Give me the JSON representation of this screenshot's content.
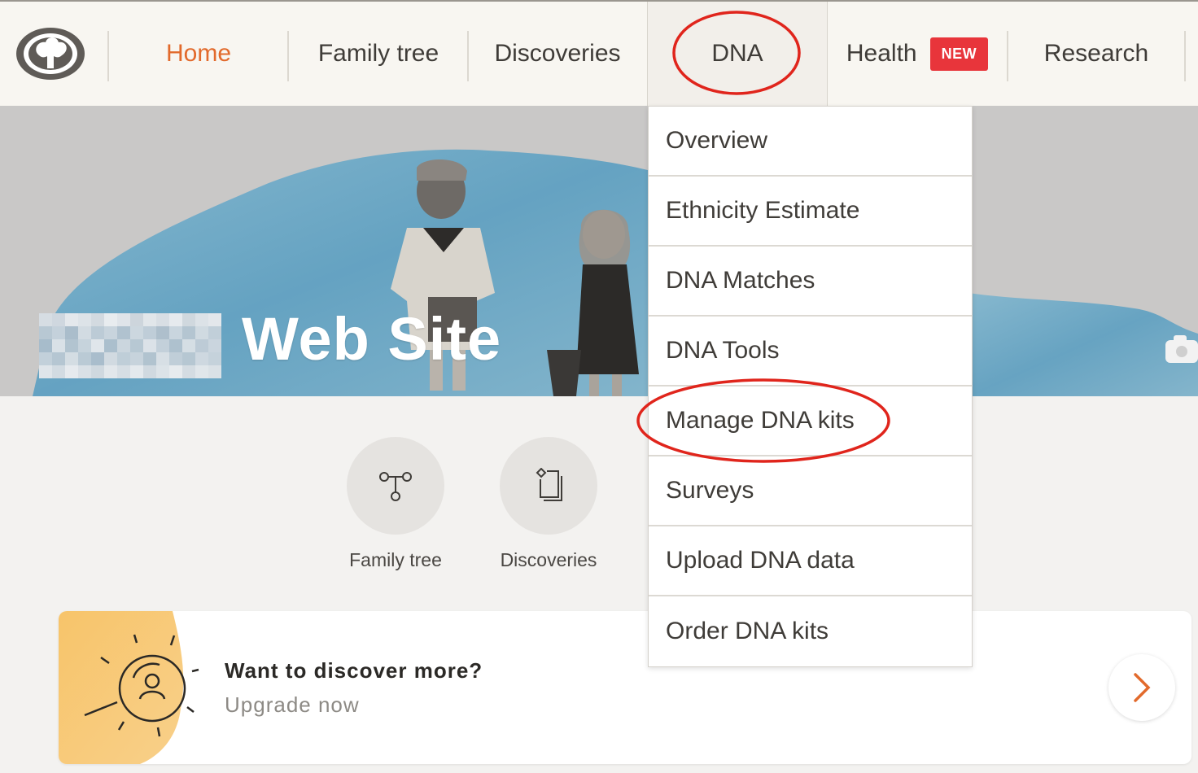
{
  "nav": {
    "items": [
      {
        "label": "Home"
      },
      {
        "label": "Family tree"
      },
      {
        "label": "Discoveries"
      },
      {
        "label": "DNA"
      },
      {
        "label": "Health",
        "badge": "NEW"
      },
      {
        "label": "Research"
      }
    ]
  },
  "hero": {
    "title": "Web Site"
  },
  "quick_links": [
    {
      "label": "Family tree",
      "icon": "family-tree-icon"
    },
    {
      "label": "Discoveries",
      "icon": "discoveries-icon"
    }
  ],
  "upgrade_card": {
    "title": "Want to discover more?",
    "subtitle": "Upgrade now"
  },
  "dna_menu": {
    "items": [
      "Overview",
      "Ethnicity Estimate",
      "DNA Matches",
      "DNA Tools",
      "Manage DNA kits",
      "Surveys",
      "Upload DNA data",
      "Order DNA kits"
    ]
  },
  "colors": {
    "accent": "#e26a2c",
    "badge": "#e8353b",
    "annotation": "#e0251c",
    "hero_blue": "#5c9fc1"
  }
}
